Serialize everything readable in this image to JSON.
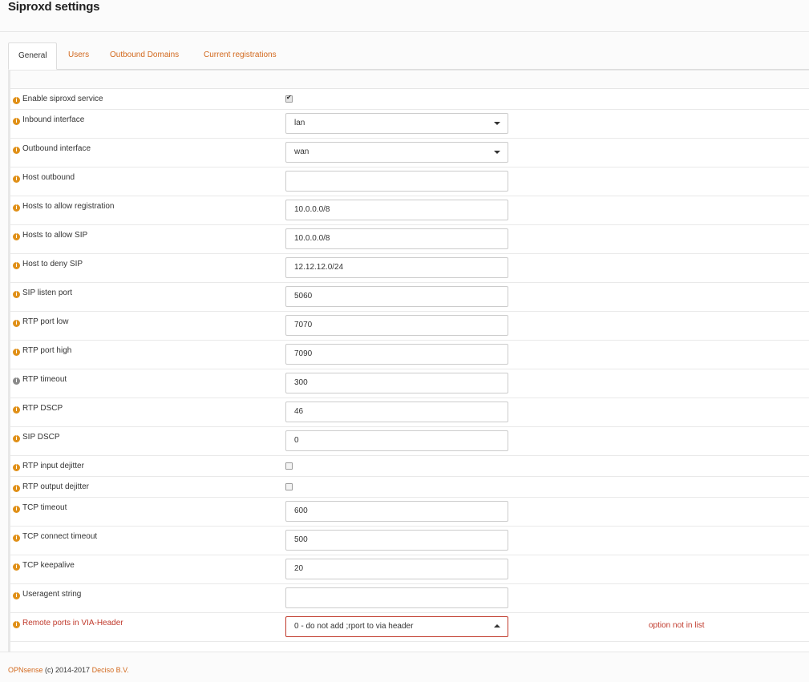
{
  "page": {
    "title": "Siproxd settings"
  },
  "tabs": [
    "General",
    "Users",
    "Outbound Domains",
    "Current registrations"
  ],
  "rows": [
    {
      "label": "Enable siproxd service",
      "type": "checkbox",
      "checked": true
    },
    {
      "label": "Inbound interface",
      "type": "select",
      "value": "lan"
    },
    {
      "label": "Outbound interface",
      "type": "select",
      "value": "wan"
    },
    {
      "label": "Host outbound",
      "type": "text",
      "value": ""
    },
    {
      "label": "Hosts to allow registration",
      "type": "text",
      "value": "10.0.0.0/8"
    },
    {
      "label": "Hosts to allow SIP",
      "type": "text",
      "value": "10.0.0.0/8"
    },
    {
      "label": "Host to deny SIP",
      "type": "text",
      "value": "12.12.12.0/24"
    },
    {
      "label": "SIP listen port",
      "type": "text",
      "value": "5060"
    },
    {
      "label": "RTP port low",
      "type": "text",
      "value": "7070"
    },
    {
      "label": "RTP port high",
      "type": "text",
      "value": "7090"
    },
    {
      "label": "RTP timeout",
      "type": "text",
      "value": "300",
      "icon_color": "grey"
    },
    {
      "label": "RTP DSCP",
      "type": "text",
      "value": "46"
    },
    {
      "label": "SIP DSCP",
      "type": "text",
      "value": "0"
    },
    {
      "label": "RTP input dejitter",
      "type": "checkbox",
      "checked": false
    },
    {
      "label": "RTP output dejitter",
      "type": "checkbox",
      "checked": false
    },
    {
      "label": "TCP timeout",
      "type": "text",
      "value": "600"
    },
    {
      "label": "TCP connect timeout",
      "type": "text",
      "value": "500"
    },
    {
      "label": "TCP keepalive",
      "type": "text",
      "value": "20"
    },
    {
      "label": "Useragent string",
      "type": "text",
      "value": ""
    },
    {
      "label": "Remote ports in VIA-Header",
      "type": "select",
      "value": "0 - do not add ;rport to via header",
      "error": "option not in list"
    }
  ],
  "footer": {
    "brand": "OPNsense",
    "copyright": " (c) 2014-2017 ",
    "company": "Deciso B.V."
  },
  "colors": {
    "accent": "#d2691e",
    "info_icon": "#e09018",
    "error": "#c0392b"
  },
  "icons": {
    "info": "info-circle-icon",
    "caret": "caret-down-icon",
    "check": "checkmark-icon"
  }
}
